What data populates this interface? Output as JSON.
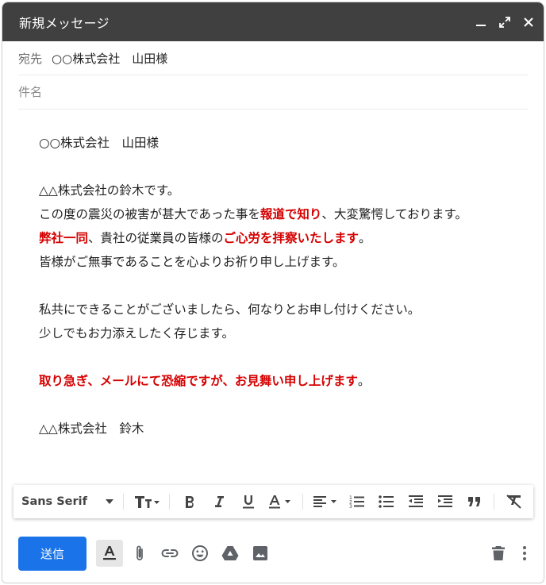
{
  "window": {
    "title": "新規メッセージ"
  },
  "fields": {
    "to_label": "宛先",
    "to_value": "○○株式会社　山田様",
    "subject_placeholder": "件名"
  },
  "body": {
    "line1": "○○株式会社　山田様",
    "line2": "△△株式会社の鈴木です。",
    "line3_a": "この度の震災の被害が甚大であった事を",
    "line3_b": "報道で知り",
    "line3_c": "、大変驚愕しております。",
    "line4_a": "弊社一同",
    "line4_b": "、貴社の従業員の皆様の",
    "line4_c": "ご心労を拝察いたします",
    "line4_d": "。",
    "line5": "皆様がご無事であることを心よりお祈り申し上げます。",
    "line6": "私共にできることがございましたら、何なりとお申し付けください。",
    "line7": "少しでもお力添えしたく存じます。",
    "line8_a": "取り急ぎ、メールにて恐縮ですが、お見舞い申し上げます",
    "line8_b": "。",
    "line9": "△△株式会社　鈴木"
  },
  "format_bar": {
    "font_name": "Sans Serif"
  },
  "bottom_bar": {
    "send_label": "送信"
  },
  "colors": {
    "titlebar": "#404040",
    "send_button": "#1a73e8",
    "emphasis_red": "#d50000"
  }
}
